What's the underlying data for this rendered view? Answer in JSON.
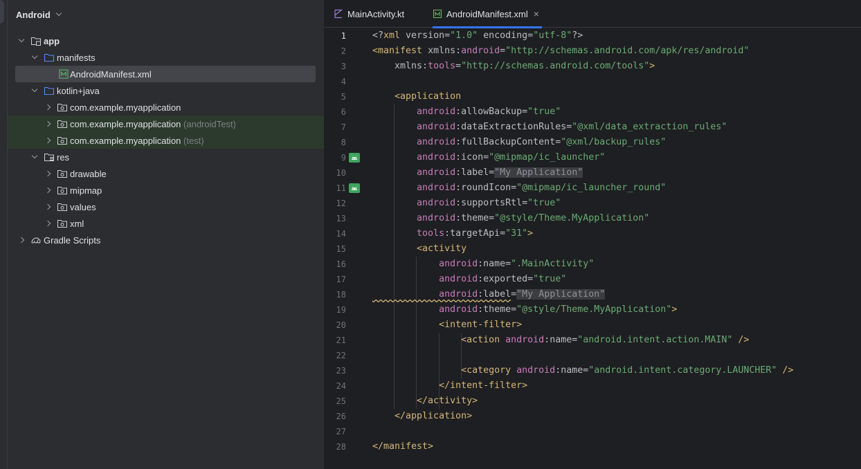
{
  "project_view": {
    "title": "Android",
    "items": [
      {
        "label": "app",
        "suffix": ""
      },
      {
        "label": "manifests",
        "suffix": ""
      },
      {
        "label": "AndroidManifest.xml",
        "suffix": ""
      },
      {
        "label": "kotlin+java",
        "suffix": ""
      },
      {
        "label": "com.example.myapplication",
        "suffix": ""
      },
      {
        "label": "com.example.myapplication",
        "suffix": "(androidTest)"
      },
      {
        "label": "com.example.myapplication",
        "suffix": "(test)"
      },
      {
        "label": "res",
        "suffix": ""
      },
      {
        "label": "drawable",
        "suffix": ""
      },
      {
        "label": "mipmap",
        "suffix": ""
      },
      {
        "label": "values",
        "suffix": ""
      },
      {
        "label": "xml",
        "suffix": ""
      },
      {
        "label": "Gradle Scripts",
        "suffix": ""
      }
    ]
  },
  "tabs": [
    {
      "label": "MainActivity.kt",
      "close": ""
    },
    {
      "label": "AndroidManifest.xml",
      "close": "×"
    }
  ],
  "editor": {
    "line_numbers": [
      "1",
      "2",
      "3",
      "4",
      "5",
      "6",
      "7",
      "8",
      "9",
      "10",
      "11",
      "12",
      "13",
      "14",
      "15",
      "16",
      "17",
      "18",
      "19",
      "20",
      "21",
      "22",
      "23",
      "24",
      "25",
      "26",
      "27",
      "28"
    ],
    "lines": [
      [
        [
          "t-punct",
          "<?"
        ],
        [
          "t-tag",
          "xml"
        ],
        [
          "t-attr",
          " version="
        ],
        [
          "t-str",
          "\"1.0\""
        ],
        [
          "t-attr",
          " encoding="
        ],
        [
          "t-str",
          "\"utf-8\""
        ],
        [
          "t-punct",
          "?>"
        ]
      ],
      [
        [
          "t-tag",
          "<manifest "
        ],
        [
          "t-attr",
          "xmlns:"
        ],
        [
          "t-ns",
          "android"
        ],
        [
          "t-attr",
          "="
        ],
        [
          "t-str",
          "\"http://schemas.android.com/apk/res/android\""
        ]
      ],
      [
        [
          "t-attr",
          "    xmlns:"
        ],
        [
          "t-ns",
          "tools"
        ],
        [
          "t-attr",
          "="
        ],
        [
          "t-str",
          "\"http://schemas.android.com/tools\""
        ],
        [
          "t-tag",
          ">"
        ]
      ],
      [],
      [
        [
          "t-tag",
          "    <application"
        ]
      ],
      [
        [
          "t-ns",
          "        android"
        ],
        [
          "t-attr",
          ":allowBackup="
        ],
        [
          "t-str",
          "\"true\""
        ]
      ],
      [
        [
          "t-ns",
          "        android"
        ],
        [
          "t-attr",
          ":dataExtractionRules="
        ],
        [
          "t-str",
          "\"@xml/data_extraction_rules\""
        ]
      ],
      [
        [
          "t-ns",
          "        android"
        ],
        [
          "t-attr",
          ":fullBackupContent="
        ],
        [
          "t-str",
          "\"@xml/backup_rules\""
        ]
      ],
      [
        [
          "t-ns",
          "        android"
        ],
        [
          "t-attr",
          ":icon="
        ],
        [
          "t-str",
          "\"@mipmap/ic_launcher\""
        ]
      ],
      [
        [
          "t-ns",
          "        android"
        ],
        [
          "t-attr",
          ":label="
        ],
        [
          "t-hl",
          "\"My Application\""
        ]
      ],
      [
        [
          "t-ns",
          "        android"
        ],
        [
          "t-attr",
          ":roundIcon="
        ],
        [
          "t-str",
          "\"@mipmap/ic_launcher_round\""
        ]
      ],
      [
        [
          "t-ns",
          "        android"
        ],
        [
          "t-attr",
          ":supportsRtl="
        ],
        [
          "t-str",
          "\"true\""
        ]
      ],
      [
        [
          "t-ns",
          "        android"
        ],
        [
          "t-attr",
          ":theme="
        ],
        [
          "t-str",
          "\"@style/Theme.MyApplication\""
        ]
      ],
      [
        [
          "t-ns",
          "        tools"
        ],
        [
          "t-attr",
          ":targetApi="
        ],
        [
          "t-str",
          "\"31\""
        ],
        [
          "t-tag",
          ">"
        ]
      ],
      [
        [
          "t-tag",
          "        <activity"
        ]
      ],
      [
        [
          "t-ns",
          "            android"
        ],
        [
          "t-attr",
          ":name="
        ],
        [
          "t-str",
          "\".MainActivity\""
        ]
      ],
      [
        [
          "t-ns",
          "            android"
        ],
        [
          "t-attr",
          ":exported="
        ],
        [
          "t-str",
          "\"true\""
        ]
      ],
      [
        [
          "t-ns t-wavy",
          "            android"
        ],
        [
          "t-attr t-wavy",
          ":label"
        ],
        [
          "t-attr",
          "="
        ],
        [
          "t-hl",
          "\"My Application\""
        ]
      ],
      [
        [
          "t-ns",
          "            android"
        ],
        [
          "t-attr",
          ":theme="
        ],
        [
          "t-str",
          "\"@style/Theme.MyApplication\""
        ],
        [
          "t-tag",
          ">"
        ]
      ],
      [
        [
          "t-tag",
          "            <intent-filter>"
        ]
      ],
      [
        [
          "t-tag",
          "                <action "
        ],
        [
          "t-ns",
          "android"
        ],
        [
          "t-attr",
          ":name="
        ],
        [
          "t-str",
          "\"android.intent.action.MAIN\""
        ],
        [
          "t-tag",
          " />"
        ]
      ],
      [],
      [
        [
          "t-tag",
          "                <category "
        ],
        [
          "t-ns",
          "android"
        ],
        [
          "t-attr",
          ":name="
        ],
        [
          "t-str",
          "\"android.intent.category.LAUNCHER\""
        ],
        [
          "t-tag",
          " />"
        ]
      ],
      [
        [
          "t-tag",
          "            </intent-filter>"
        ]
      ],
      [
        [
          "t-tag",
          "        </activity>"
        ]
      ],
      [
        [
          "t-tag",
          "    </application>"
        ]
      ],
      [],
      [
        [
          "t-tag",
          "</manifest>"
        ]
      ]
    ]
  },
  "icons": {
    "folder": "folder-icon",
    "module": "module-folder-icon",
    "package": "package-icon",
    "manifest": "manifest-file-icon",
    "gradle": "gradle-icon",
    "kotlin": "kotlin-file-icon",
    "android_gutter": "android-gutter-icon"
  },
  "colors": {
    "accent": "#3574f0",
    "tag": "#d5b778",
    "namespace": "#c77dbb",
    "string": "#6aab73",
    "android_green": "#3ea55d"
  }
}
